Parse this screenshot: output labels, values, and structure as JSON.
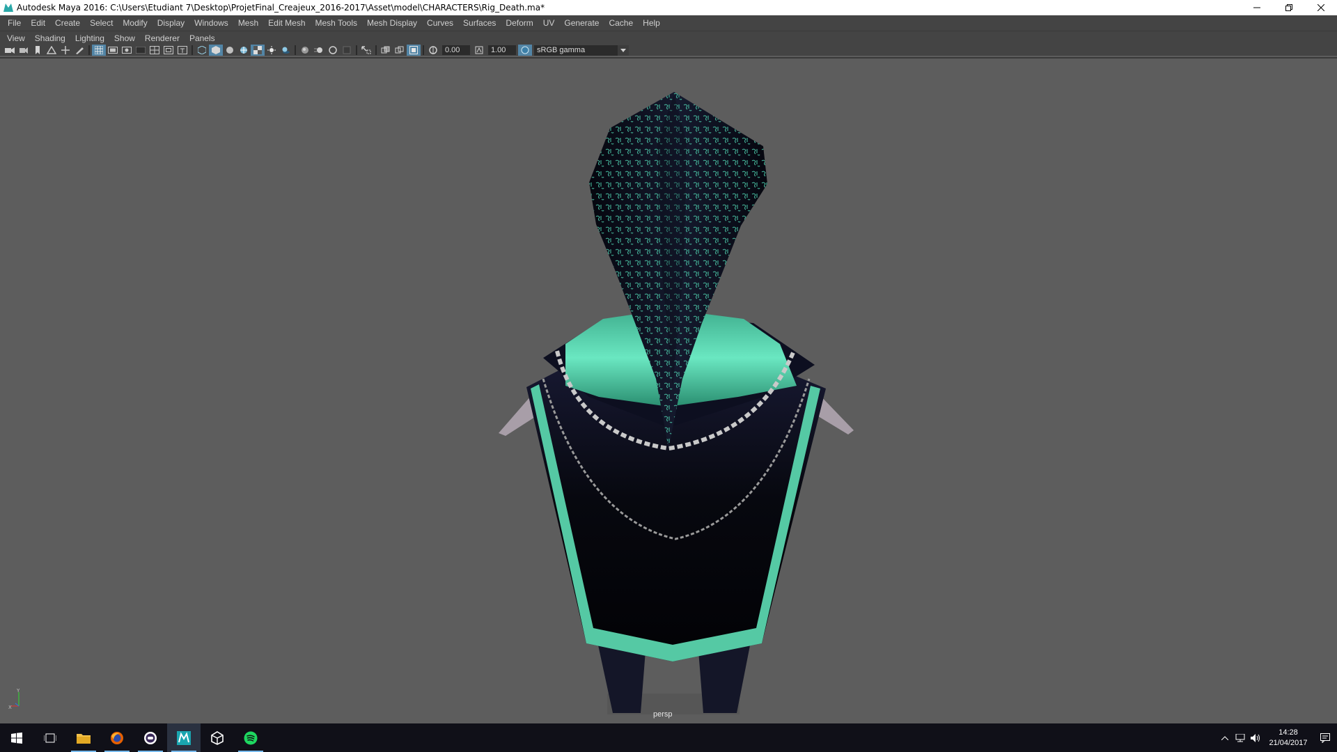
{
  "window": {
    "title": "Autodesk Maya 2016: C:\\Users\\Etudiant 7\\Desktop\\ProjetFinal_Creajeux_2016-2017\\Asset\\model\\CHARACTERS\\Rig_Death.ma*"
  },
  "menubar": [
    "File",
    "Edit",
    "Create",
    "Select",
    "Modify",
    "Display",
    "Windows",
    "Mesh",
    "Edit Mesh",
    "Mesh Tools",
    "Mesh Display",
    "Curves",
    "Surfaces",
    "Deform",
    "UV",
    "Generate",
    "Cache",
    "Help"
  ],
  "panel_menu": [
    "View",
    "Shading",
    "Lighting",
    "Show",
    "Renderer",
    "Panels"
  ],
  "toolbar": {
    "exposure_value": "0.00",
    "gamma_value": "1.00",
    "color_space": "sRGB gamma"
  },
  "viewport": {
    "camera_label": "persp",
    "axis_y_label": "Y",
    "axis_x_label": "X"
  },
  "taskbar": {
    "time": "14:28",
    "date": "21/04/2017"
  },
  "colors": {
    "accent_teal": "#55c9a4",
    "robe_dark": "#0b0d1e",
    "viewport_bg": "#5d5d5d",
    "active_tool": "#5285a6"
  }
}
